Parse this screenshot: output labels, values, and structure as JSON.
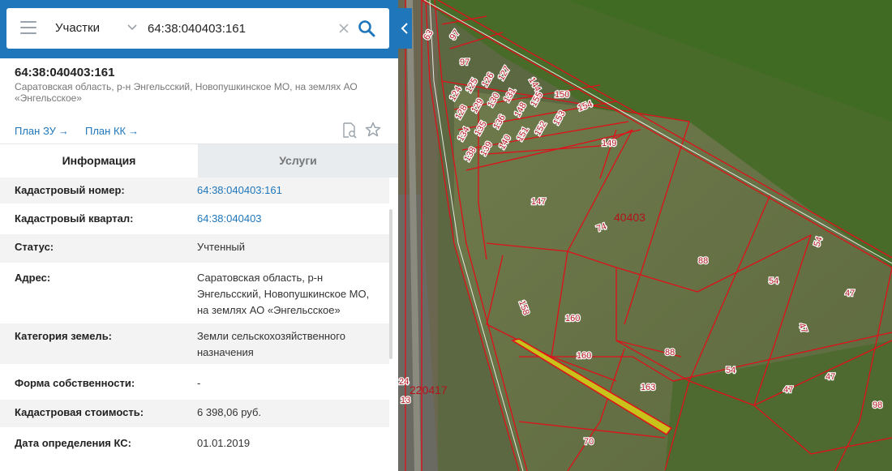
{
  "search": {
    "type_label": "Участки",
    "query": "64:38:040403:161"
  },
  "parcel": {
    "title": "64:38:040403:161",
    "address": "Саратовская область, р-н Энгельсский, Новопушкинское МО, на землях АО «Энгельсское»",
    "plan_zu": "План ЗУ",
    "plan_kk": "План КК"
  },
  "tabs": {
    "info": "Информация",
    "services": "Услуги"
  },
  "info_rows": [
    {
      "label": "Кадастровый номер:",
      "value": "64:38:040403:161",
      "link": true
    },
    {
      "label": "Кадастровый квартал:",
      "value": "64:38:040403",
      "link": true
    },
    {
      "label": "Статус:",
      "value": "Учтенный",
      "link": false
    },
    {
      "label": "Адрес:",
      "value": "Саратовская область, р-н Энгельсский, Новопушкинское МО, на землях АО «Энгельсское»",
      "link": false
    },
    {
      "label": "Категория земель:",
      "value": "Земли сельскохозяйственного назначения",
      "link": false
    },
    {
      "label": "Форма собственности:",
      "value": "-",
      "link": false
    },
    {
      "label": "Кадастровая стоимость:",
      "value": "6 398,06 руб.",
      "link": false
    },
    {
      "label": "Дата определения КС:",
      "value": "01.01.2019",
      "link": false
    }
  ],
  "map": {
    "quarter_label": "40403",
    "quarter_label_2": "220417",
    "parcel_labels": [
      "63",
      "97",
      "97",
      "124",
      "125",
      "126",
      "127",
      "144",
      "128",
      "129",
      "130",
      "131",
      "148",
      "155",
      "150",
      "134",
      "135",
      "136",
      "154",
      "138",
      "139",
      "140",
      "151",
      "152",
      "153",
      "149",
      "147",
      "74",
      "88",
      "54",
      "54",
      "47",
      "158",
      "160",
      "160",
      "88",
      "47",
      "54",
      "47",
      "163",
      "47",
      "98",
      "70",
      "24",
      "13"
    ]
  },
  "colors": {
    "brand_blue": "#1f76bb",
    "parcel_border": "#e0101a",
    "selected_fill": "#c9c21a"
  },
  "icons": {
    "menu": "menu-icon",
    "chevron": "chevron-down-icon",
    "clear": "close-icon",
    "search": "search-icon",
    "collapse": "chevron-left-icon",
    "doc": "document-search-icon",
    "favorite": "star-icon"
  }
}
